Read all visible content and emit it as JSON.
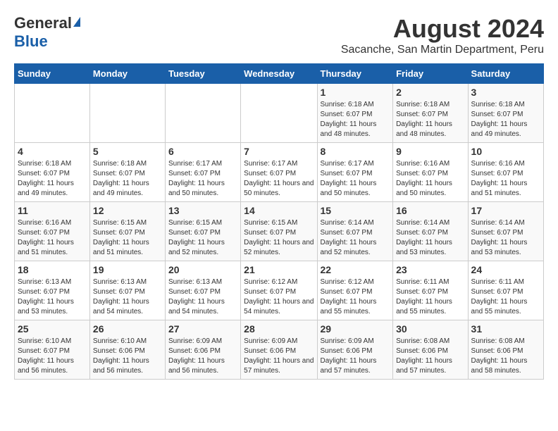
{
  "logo": {
    "general": "General",
    "blue": "Blue"
  },
  "title": "August 2024",
  "subtitle": "Sacanche, San Martin Department, Peru",
  "days_of_week": [
    "Sunday",
    "Monday",
    "Tuesday",
    "Wednesday",
    "Thursday",
    "Friday",
    "Saturday"
  ],
  "weeks": [
    [
      {
        "day": "",
        "info": ""
      },
      {
        "day": "",
        "info": ""
      },
      {
        "day": "",
        "info": ""
      },
      {
        "day": "",
        "info": ""
      },
      {
        "day": "1",
        "sunrise": "Sunrise: 6:18 AM",
        "sunset": "Sunset: 6:07 PM",
        "daylight": "Daylight: 11 hours and 48 minutes."
      },
      {
        "day": "2",
        "sunrise": "Sunrise: 6:18 AM",
        "sunset": "Sunset: 6:07 PM",
        "daylight": "Daylight: 11 hours and 48 minutes."
      },
      {
        "day": "3",
        "sunrise": "Sunrise: 6:18 AM",
        "sunset": "Sunset: 6:07 PM",
        "daylight": "Daylight: 11 hours and 49 minutes."
      }
    ],
    [
      {
        "day": "4",
        "sunrise": "Sunrise: 6:18 AM",
        "sunset": "Sunset: 6:07 PM",
        "daylight": "Daylight: 11 hours and 49 minutes."
      },
      {
        "day": "5",
        "sunrise": "Sunrise: 6:18 AM",
        "sunset": "Sunset: 6:07 PM",
        "daylight": "Daylight: 11 hours and 49 minutes."
      },
      {
        "day": "6",
        "sunrise": "Sunrise: 6:17 AM",
        "sunset": "Sunset: 6:07 PM",
        "daylight": "Daylight: 11 hours and 50 minutes."
      },
      {
        "day": "7",
        "sunrise": "Sunrise: 6:17 AM",
        "sunset": "Sunset: 6:07 PM",
        "daylight": "Daylight: 11 hours and 50 minutes."
      },
      {
        "day": "8",
        "sunrise": "Sunrise: 6:17 AM",
        "sunset": "Sunset: 6:07 PM",
        "daylight": "Daylight: 11 hours and 50 minutes."
      },
      {
        "day": "9",
        "sunrise": "Sunrise: 6:16 AM",
        "sunset": "Sunset: 6:07 PM",
        "daylight": "Daylight: 11 hours and 50 minutes."
      },
      {
        "day": "10",
        "sunrise": "Sunrise: 6:16 AM",
        "sunset": "Sunset: 6:07 PM",
        "daylight": "Daylight: 11 hours and 51 minutes."
      }
    ],
    [
      {
        "day": "11",
        "sunrise": "Sunrise: 6:16 AM",
        "sunset": "Sunset: 6:07 PM",
        "daylight": "Daylight: 11 hours and 51 minutes."
      },
      {
        "day": "12",
        "sunrise": "Sunrise: 6:15 AM",
        "sunset": "Sunset: 6:07 PM",
        "daylight": "Daylight: 11 hours and 51 minutes."
      },
      {
        "day": "13",
        "sunrise": "Sunrise: 6:15 AM",
        "sunset": "Sunset: 6:07 PM",
        "daylight": "Daylight: 11 hours and 52 minutes."
      },
      {
        "day": "14",
        "sunrise": "Sunrise: 6:15 AM",
        "sunset": "Sunset: 6:07 PM",
        "daylight": "Daylight: 11 hours and 52 minutes."
      },
      {
        "day": "15",
        "sunrise": "Sunrise: 6:14 AM",
        "sunset": "Sunset: 6:07 PM",
        "daylight": "Daylight: 11 hours and 52 minutes."
      },
      {
        "day": "16",
        "sunrise": "Sunrise: 6:14 AM",
        "sunset": "Sunset: 6:07 PM",
        "daylight": "Daylight: 11 hours and 53 minutes."
      },
      {
        "day": "17",
        "sunrise": "Sunrise: 6:14 AM",
        "sunset": "Sunset: 6:07 PM",
        "daylight": "Daylight: 11 hours and 53 minutes."
      }
    ],
    [
      {
        "day": "18",
        "sunrise": "Sunrise: 6:13 AM",
        "sunset": "Sunset: 6:07 PM",
        "daylight": "Daylight: 11 hours and 53 minutes."
      },
      {
        "day": "19",
        "sunrise": "Sunrise: 6:13 AM",
        "sunset": "Sunset: 6:07 PM",
        "daylight": "Daylight: 11 hours and 54 minutes."
      },
      {
        "day": "20",
        "sunrise": "Sunrise: 6:13 AM",
        "sunset": "Sunset: 6:07 PM",
        "daylight": "Daylight: 11 hours and 54 minutes."
      },
      {
        "day": "21",
        "sunrise": "Sunrise: 6:12 AM",
        "sunset": "Sunset: 6:07 PM",
        "daylight": "Daylight: 11 hours and 54 minutes."
      },
      {
        "day": "22",
        "sunrise": "Sunrise: 6:12 AM",
        "sunset": "Sunset: 6:07 PM",
        "daylight": "Daylight: 11 hours and 55 minutes."
      },
      {
        "day": "23",
        "sunrise": "Sunrise: 6:11 AM",
        "sunset": "Sunset: 6:07 PM",
        "daylight": "Daylight: 11 hours and 55 minutes."
      },
      {
        "day": "24",
        "sunrise": "Sunrise: 6:11 AM",
        "sunset": "Sunset: 6:07 PM",
        "daylight": "Daylight: 11 hours and 55 minutes."
      }
    ],
    [
      {
        "day": "25",
        "sunrise": "Sunrise: 6:10 AM",
        "sunset": "Sunset: 6:07 PM",
        "daylight": "Daylight: 11 hours and 56 minutes."
      },
      {
        "day": "26",
        "sunrise": "Sunrise: 6:10 AM",
        "sunset": "Sunset: 6:06 PM",
        "daylight": "Daylight: 11 hours and 56 minutes."
      },
      {
        "day": "27",
        "sunrise": "Sunrise: 6:09 AM",
        "sunset": "Sunset: 6:06 PM",
        "daylight": "Daylight: 11 hours and 56 minutes."
      },
      {
        "day": "28",
        "sunrise": "Sunrise: 6:09 AM",
        "sunset": "Sunset: 6:06 PM",
        "daylight": "Daylight: 11 hours and 57 minutes."
      },
      {
        "day": "29",
        "sunrise": "Sunrise: 6:09 AM",
        "sunset": "Sunset: 6:06 PM",
        "daylight": "Daylight: 11 hours and 57 minutes."
      },
      {
        "day": "30",
        "sunrise": "Sunrise: 6:08 AM",
        "sunset": "Sunset: 6:06 PM",
        "daylight": "Daylight: 11 hours and 57 minutes."
      },
      {
        "day": "31",
        "sunrise": "Sunrise: 6:08 AM",
        "sunset": "Sunset: 6:06 PM",
        "daylight": "Daylight: 11 hours and 58 minutes."
      }
    ]
  ]
}
